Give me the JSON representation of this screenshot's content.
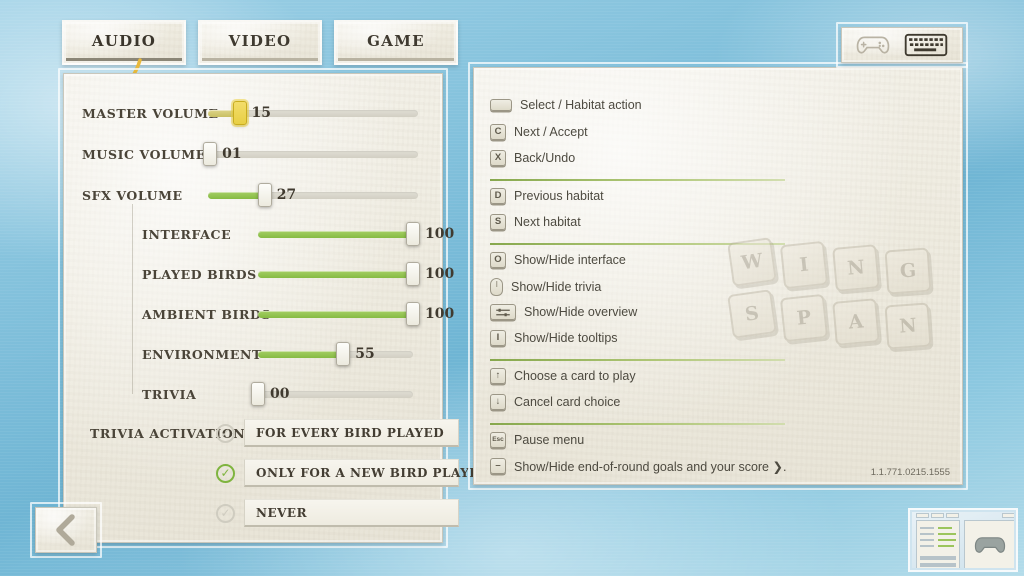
{
  "app": {
    "name": "Wingspan",
    "version": "1.1.771.0215.1555"
  },
  "tabs": [
    {
      "label": "Audio",
      "active": true
    },
    {
      "label": "Video",
      "active": false
    },
    {
      "label": "Game",
      "active": false
    }
  ],
  "input_toggle": {
    "gamepad_icon": "gamepad-icon",
    "keyboard_icon": "keyboard-icon",
    "selected": "keyboard"
  },
  "audio": {
    "main_sliders": [
      {
        "label": "Master volume",
        "value": "15",
        "pct": 15,
        "highlight": true
      },
      {
        "label": "Music volume",
        "value": "01",
        "pct": 1,
        "highlight": false
      },
      {
        "label": "SFX volume",
        "value": "27",
        "pct": 27,
        "highlight": false
      }
    ],
    "sub_sliders": [
      {
        "label": "Interface",
        "value": "100",
        "pct": 100
      },
      {
        "label": "Played birds",
        "value": "100",
        "pct": 100
      },
      {
        "label": "Ambient birds",
        "value": "100",
        "pct": 100
      },
      {
        "label": "Environment",
        "value": "55",
        "pct": 55
      },
      {
        "label": "Trivia",
        "value": "00",
        "pct": 0
      }
    ],
    "trivia_activation": {
      "label": "Trivia activation:",
      "options": [
        {
          "label": "For every bird played",
          "selected": false
        },
        {
          "label": "Only for a new bird played",
          "selected": true
        },
        {
          "label": "Never",
          "selected": false
        }
      ]
    }
  },
  "keybinds": {
    "groups": [
      {
        "rows": [
          {
            "key": "",
            "key_type": "space",
            "icon": "spacebar-key-icon",
            "action": "Select / Habitat action"
          },
          {
            "key": "C",
            "key_type": "square",
            "icon": "c-key-icon",
            "action": "Next / Accept"
          },
          {
            "key": "X",
            "key_type": "square",
            "icon": "x-key-icon",
            "action": "Back/Undo"
          }
        ]
      },
      {
        "rows": [
          {
            "key": "D",
            "key_type": "square",
            "icon": "d-key-icon",
            "action": "Previous habitat"
          },
          {
            "key": "S",
            "key_type": "square",
            "icon": "s-key-icon",
            "action": "Next habitat"
          }
        ]
      },
      {
        "rows": [
          {
            "key": "O",
            "key_type": "square",
            "icon": "o-key-icon",
            "action": "Show/Hide interface"
          },
          {
            "key": "",
            "key_type": "mouse",
            "icon": "mouse-icon",
            "action": "Show/Hide trivia"
          },
          {
            "key": "",
            "key_type": "wide",
            "icon": "tab-key-icon",
            "action": "Show/Hide overview"
          },
          {
            "key": "I",
            "key_type": "square",
            "icon": "i-key-icon",
            "action": "Show/Hide tooltips"
          }
        ]
      },
      {
        "rows": [
          {
            "key": "↑",
            "key_type": "square",
            "icon": "arrow-up-key-icon",
            "action": "Choose a card to play"
          },
          {
            "key": "↓",
            "key_type": "square",
            "icon": "arrow-down-key-icon",
            "action": "Cancel card choice"
          }
        ]
      },
      {
        "rows": [
          {
            "key": "Esc",
            "key_type": "esc",
            "icon": "esc-key-icon",
            "action": "Pause menu"
          },
          {
            "key": "–",
            "key_type": "square",
            "icon": "minus-key-icon",
            "action": "Show/Hide end-of-round goals and your score ❯."
          }
        ]
      }
    ]
  },
  "watermark": {
    "top": [
      "W",
      "I",
      "N",
      "G"
    ],
    "bottom": [
      "S",
      "P",
      "A",
      "N"
    ]
  },
  "back_button": {
    "icon": "back-chevron-icon",
    "label": ""
  },
  "thumbnail": {
    "name": "settings-preview-thumbnail"
  },
  "colors": {
    "slider_fill": "#8CBF43",
    "slider_fill_gold": "#C9BF63",
    "separator_green": "#7BA03C",
    "paper": "#F0EDE2",
    "sky": "#7FC0DE",
    "text": "#4A4438"
  }
}
